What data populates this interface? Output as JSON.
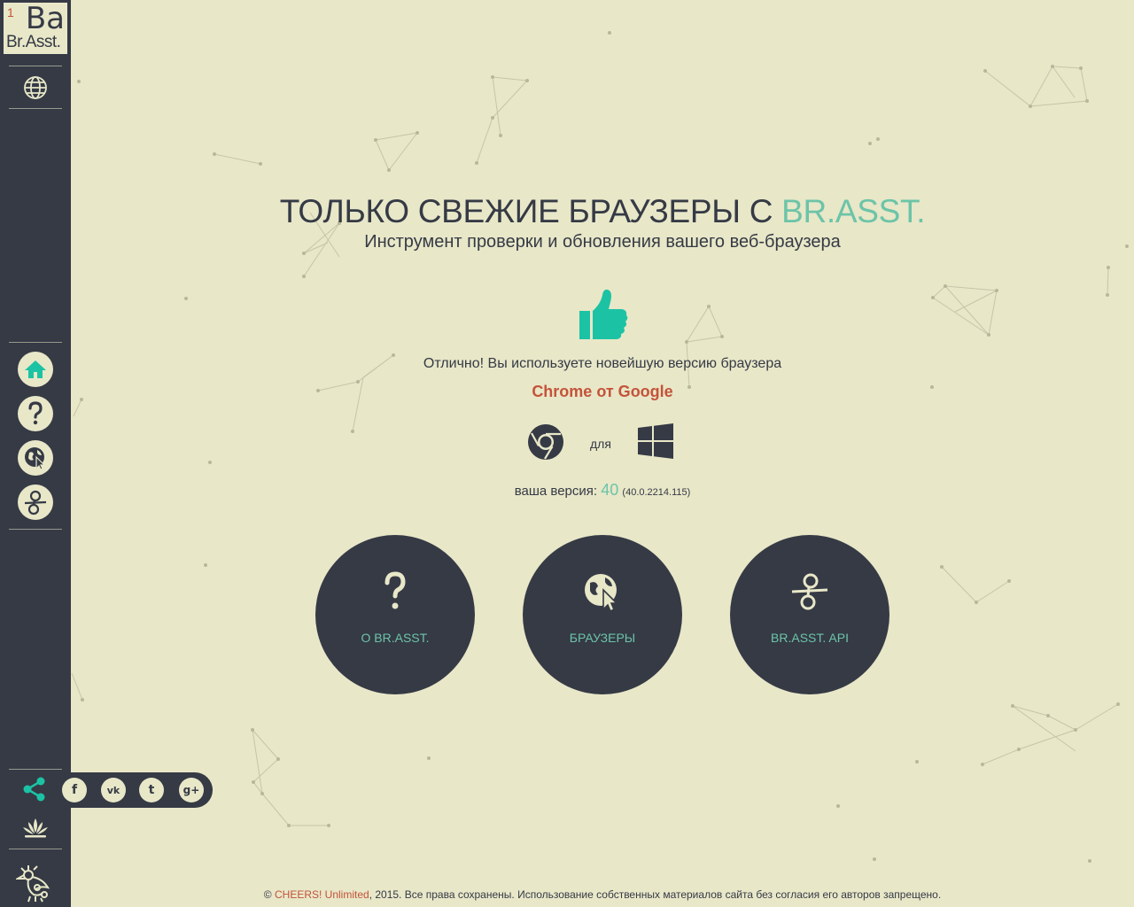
{
  "colors": {
    "background": "#e8e7c8",
    "sidebar": "#353a45",
    "accent_teal": "#6cc4a8",
    "accent_green": "#1bc3a4",
    "accent_red": "#c4533a"
  },
  "logo": {
    "number": "1",
    "symbol": "Ba",
    "name": "Br.Asst."
  },
  "sidebar": {
    "language_icon": "globe-icon",
    "nav": [
      {
        "icon": "home-icon",
        "active": true
      },
      {
        "icon": "question-icon",
        "active": false
      },
      {
        "icon": "browser-globe-icon",
        "active": false
      },
      {
        "icon": "api-icon",
        "active": false
      }
    ],
    "share_icon": "share-icon",
    "social": [
      {
        "icon": "facebook-icon",
        "glyph": "f"
      },
      {
        "icon": "vk-icon",
        "glyph": "vk"
      },
      {
        "icon": "twitter-icon",
        "glyph": "t"
      },
      {
        "icon": "google-plus-icon",
        "glyph": "g+"
      }
    ]
  },
  "hero": {
    "title": "ТОЛЬКО СВЕЖИЕ БРАУЗЕРЫ С ",
    "title_accent": "BR.ASST.",
    "subtitle": "Инструмент проверки и обновления вашего веб-браузера"
  },
  "status": {
    "message": "Отлично! Вы используете новейшую версию браузера",
    "browser": "Chrome от Google",
    "for_label": "для",
    "version_label": "ваша версия: ",
    "version_major": "40",
    "version_full": "(40.0.2214.115)"
  },
  "buttons": [
    {
      "label": "О BR.ASST.",
      "icon": "question-icon"
    },
    {
      "label": "БРАУЗЕРЫ",
      "icon": "browser-globe-icon"
    },
    {
      "label": "BR.ASST. API",
      "icon": "api-icon"
    }
  ],
  "footer": {
    "copyright": "© ",
    "brand": "CHEERS! Unlimited",
    "text": ", 2015. Все права сохранены. Использование собственных материалов сайта без согласия его авторов запрещено."
  }
}
